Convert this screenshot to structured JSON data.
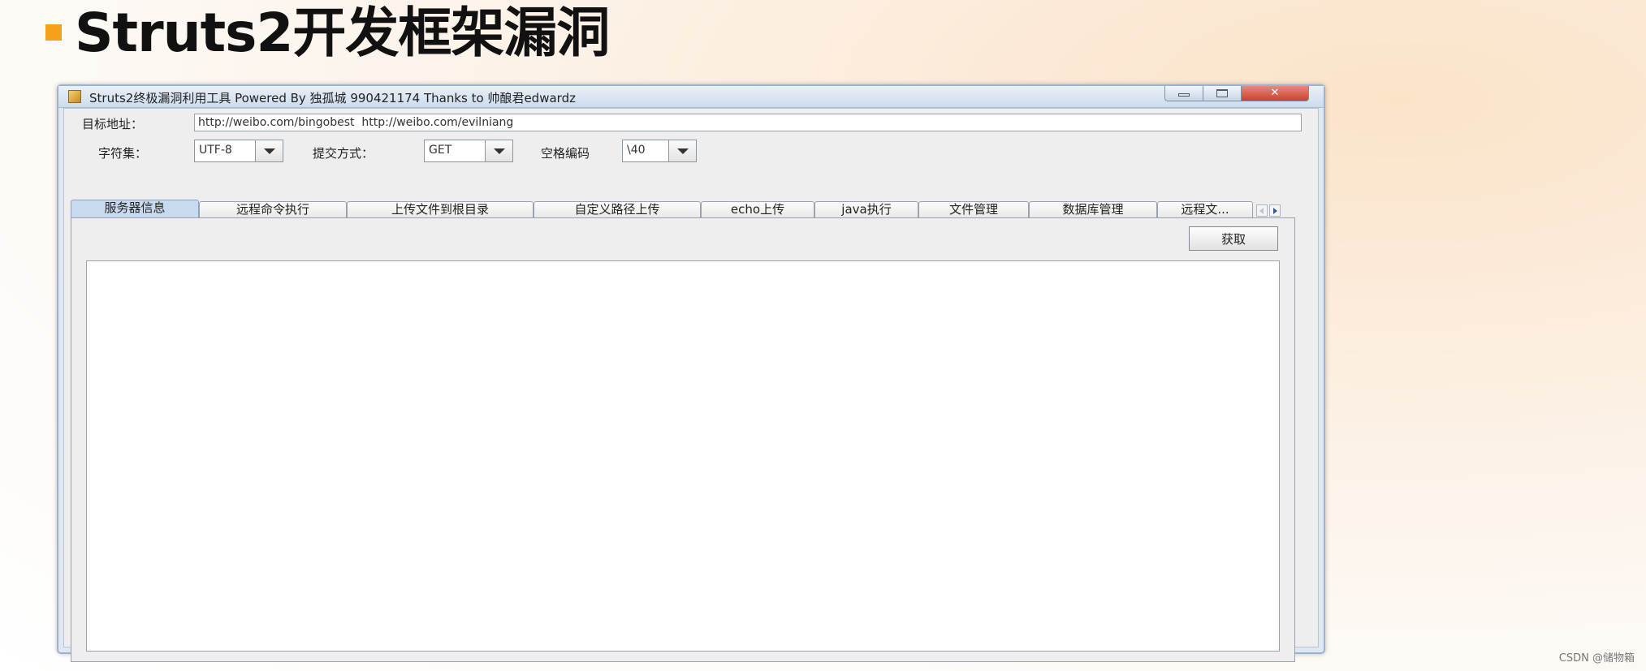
{
  "slide": {
    "title": "Struts2开发框架漏洞"
  },
  "window": {
    "title": "Struts2终极漏洞利用工具   Powered By 独孤城 990421174 Thanks to 帅酿君edwardz",
    "controls": {
      "minimize": "minimize-icon",
      "maximize": "maximize-icon",
      "close": "✕"
    }
  },
  "form": {
    "target_label": "目标地址：",
    "target_value": "http://weibo.com/bingobest  http://weibo.com/evilniang",
    "charset_label": "字符集：",
    "charset_value": "UTF-8",
    "method_label": "提交方式：",
    "method_value": "GET",
    "space_label": "空格编码",
    "space_value": "\\40"
  },
  "tabs": [
    {
      "label": "服务器信息"
    },
    {
      "label": "远程命令执行"
    },
    {
      "label": "上传文件到根目录"
    },
    {
      "label": "自定义路径上传"
    },
    {
      "label": "echo上传"
    },
    {
      "label": "java执行"
    },
    {
      "label": "文件管理"
    },
    {
      "label": "数据库管理"
    },
    {
      "label": "远程文..."
    }
  ],
  "panel": {
    "fetch_button": "获取",
    "output": ""
  },
  "footer": {
    "watermark": "CSDN @储物箱"
  },
  "colors": {
    "bullet": "#f5a01a",
    "active_tab": "#c8daf0",
    "close_button": "#c8432c"
  }
}
